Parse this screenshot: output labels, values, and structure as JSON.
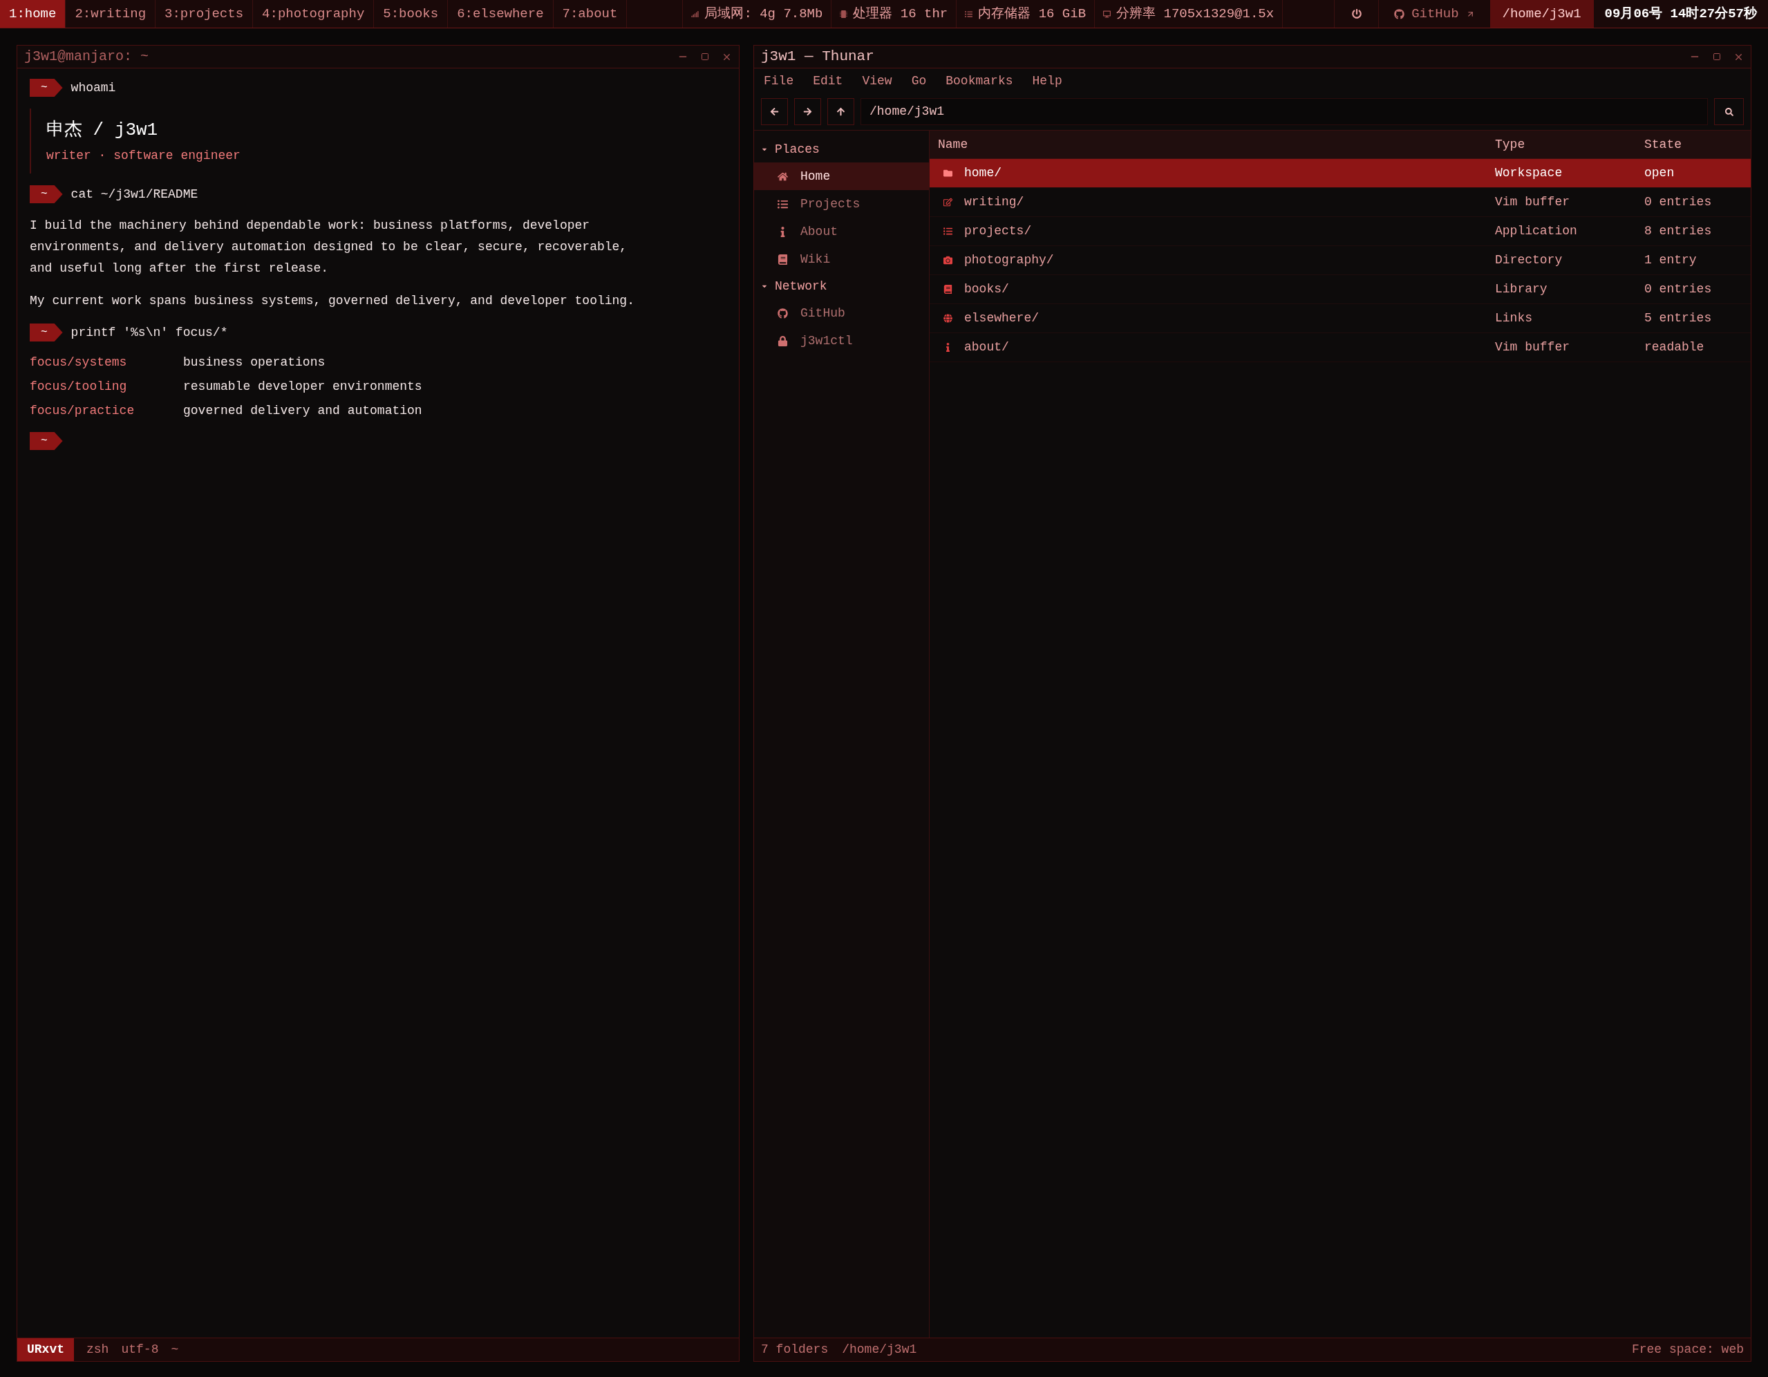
{
  "top_bar": {
    "workspaces": [
      {
        "label": "1:home",
        "selected": true
      },
      {
        "label": "2:writing",
        "selected": false
      },
      {
        "label": "3:projects",
        "selected": false
      },
      {
        "label": "4:photography",
        "selected": false
      },
      {
        "label": "5:books",
        "selected": false
      },
      {
        "label": "6:elsewhere",
        "selected": false
      },
      {
        "label": "7:about",
        "selected": false
      }
    ],
    "status": [
      {
        "kind": "signal",
        "text": "局域网: 4g 7.8Mb"
      },
      {
        "kind": "cpu",
        "text": "处理器 16 thr"
      },
      {
        "kind": "memory",
        "text": "内存储器 16 GiB"
      },
      {
        "kind": "display",
        "text": "分辨率 1705x1329@1.5x"
      }
    ],
    "github": "GitHub",
    "path": "/home/j3w1",
    "clock": "09月06号 14时27分57秒"
  },
  "terminal": {
    "title": "j3w1@manjaro: ~",
    "blocks": [
      {
        "kind": "prompt",
        "symbol": "~",
        "command": "whoami"
      },
      {
        "kind": "identity",
        "name": "申杰 / j3w1",
        "subtitle": "writer · software engineer"
      },
      {
        "kind": "prompt",
        "symbol": "~",
        "command": "cat ~/j3w1/README"
      },
      {
        "kind": "paragraph",
        "text": "I build the machinery behind dependable work: business platforms, developer environments, and delivery automation designed to be clear, secure, recoverable, and useful long after the first release."
      },
      {
        "kind": "paragraph",
        "text": "My current work spans business systems, governed delivery, and developer tooling."
      },
      {
        "kind": "prompt",
        "symbol": "~",
        "command": "printf '%s\\n' focus/*"
      },
      {
        "kind": "table",
        "rows": [
          {
            "key": "focus/systems",
            "value": "business operations"
          },
          {
            "key": "focus/tooling",
            "value": "resumable developer environments"
          },
          {
            "key": "focus/practice",
            "value": "governed delivery and automation"
          }
        ]
      },
      {
        "kind": "prompt",
        "symbol": "~"
      }
    ],
    "status_bar": {
      "app": "URxvt",
      "items": [
        "zsh",
        "utf-8",
        "~"
      ]
    }
  },
  "file_manager": {
    "title": "j3w1 — Thunar",
    "menu": [
      "File",
      "Edit",
      "View",
      "Go",
      "Bookmarks",
      "Help"
    ],
    "path": "/home/j3w1",
    "sidebar": [
      {
        "label": "Places",
        "expanded": true,
        "items": [
          {
            "label": "Home",
            "kind": "home",
            "selected": true
          },
          {
            "label": "Projects",
            "kind": "list",
            "selected": false
          },
          {
            "label": "About",
            "kind": "info",
            "selected": false
          },
          {
            "label": "Wiki",
            "kind": "book",
            "selected": false
          }
        ]
      },
      {
        "label": "Network",
        "expanded": true,
        "items": [
          {
            "label": "GitHub",
            "kind": "github",
            "selected": false
          },
          {
            "label": "j3w1ctl",
            "kind": "lock",
            "selected": false
          }
        ]
      }
    ],
    "columns": [
      "Name",
      "Type",
      "State"
    ],
    "rows": [
      {
        "name": "home/",
        "type": "Workspace",
        "state": "open",
        "kind": "folder",
        "selected": true
      },
      {
        "name": "writing/",
        "type": "Vim buffer",
        "state": "0 entries",
        "kind": "edit",
        "selected": false
      },
      {
        "name": "projects/",
        "type": "Application",
        "state": "8 entries",
        "kind": "list",
        "selected": false
      },
      {
        "name": "photography/",
        "type": "Directory",
        "state": "1 entry",
        "kind": "camera",
        "selected": false
      },
      {
        "name": "books/",
        "type": "Library",
        "state": "0 entries",
        "kind": "book",
        "selected": false
      },
      {
        "name": "elsewhere/",
        "type": "Links",
        "state": "5 entries",
        "kind": "globe",
        "selected": false
      },
      {
        "name": "about/",
        "type": "Vim buffer",
        "state": "readable",
        "kind": "info",
        "selected": false
      }
    ],
    "status_left": [
      "7 folders",
      "/home/j3w1"
    ],
    "status_right": "Free space: web"
  }
}
